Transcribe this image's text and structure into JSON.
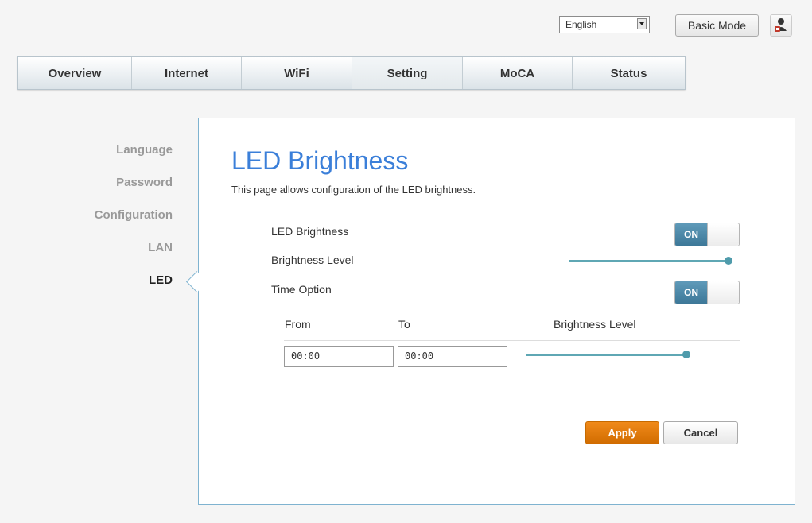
{
  "header": {
    "language_selected": "English",
    "mode_button": "Basic Mode",
    "user_icon": "user-admin-icon"
  },
  "tabs": [
    {
      "label": "Overview"
    },
    {
      "label": "Internet"
    },
    {
      "label": "WiFi"
    },
    {
      "label": "Setting",
      "active": true
    },
    {
      "label": "MoCA"
    },
    {
      "label": "Status"
    }
  ],
  "sidebar": {
    "items": [
      {
        "label": "Language"
      },
      {
        "label": "Password"
      },
      {
        "label": "Configuration"
      },
      {
        "label": "LAN"
      },
      {
        "label": "LED",
        "active": true
      }
    ]
  },
  "main": {
    "title": "LED Brightness",
    "description": "This page allows configuration of the LED brightness.",
    "led_brightness_label": "LED Brightness",
    "led_brightness_toggle": "ON",
    "brightness_level_label": "Brightness Level",
    "brightness_level_value": 1.0,
    "time_option_label": "Time Option",
    "time_option_toggle": "ON",
    "schedule": {
      "from_label": "From",
      "to_label": "To",
      "level_label": "Brightness Level",
      "from_value": "00:00",
      "to_value": "00:00",
      "level_value": 1.0
    },
    "apply_label": "Apply",
    "cancel_label": "Cancel"
  },
  "colors": {
    "accent": "#3b7fd9",
    "toggle_on": "#4a87a8",
    "slider": "#5fa7b4",
    "apply": "#e07a0b",
    "panel_border": "#7fb3d0"
  }
}
